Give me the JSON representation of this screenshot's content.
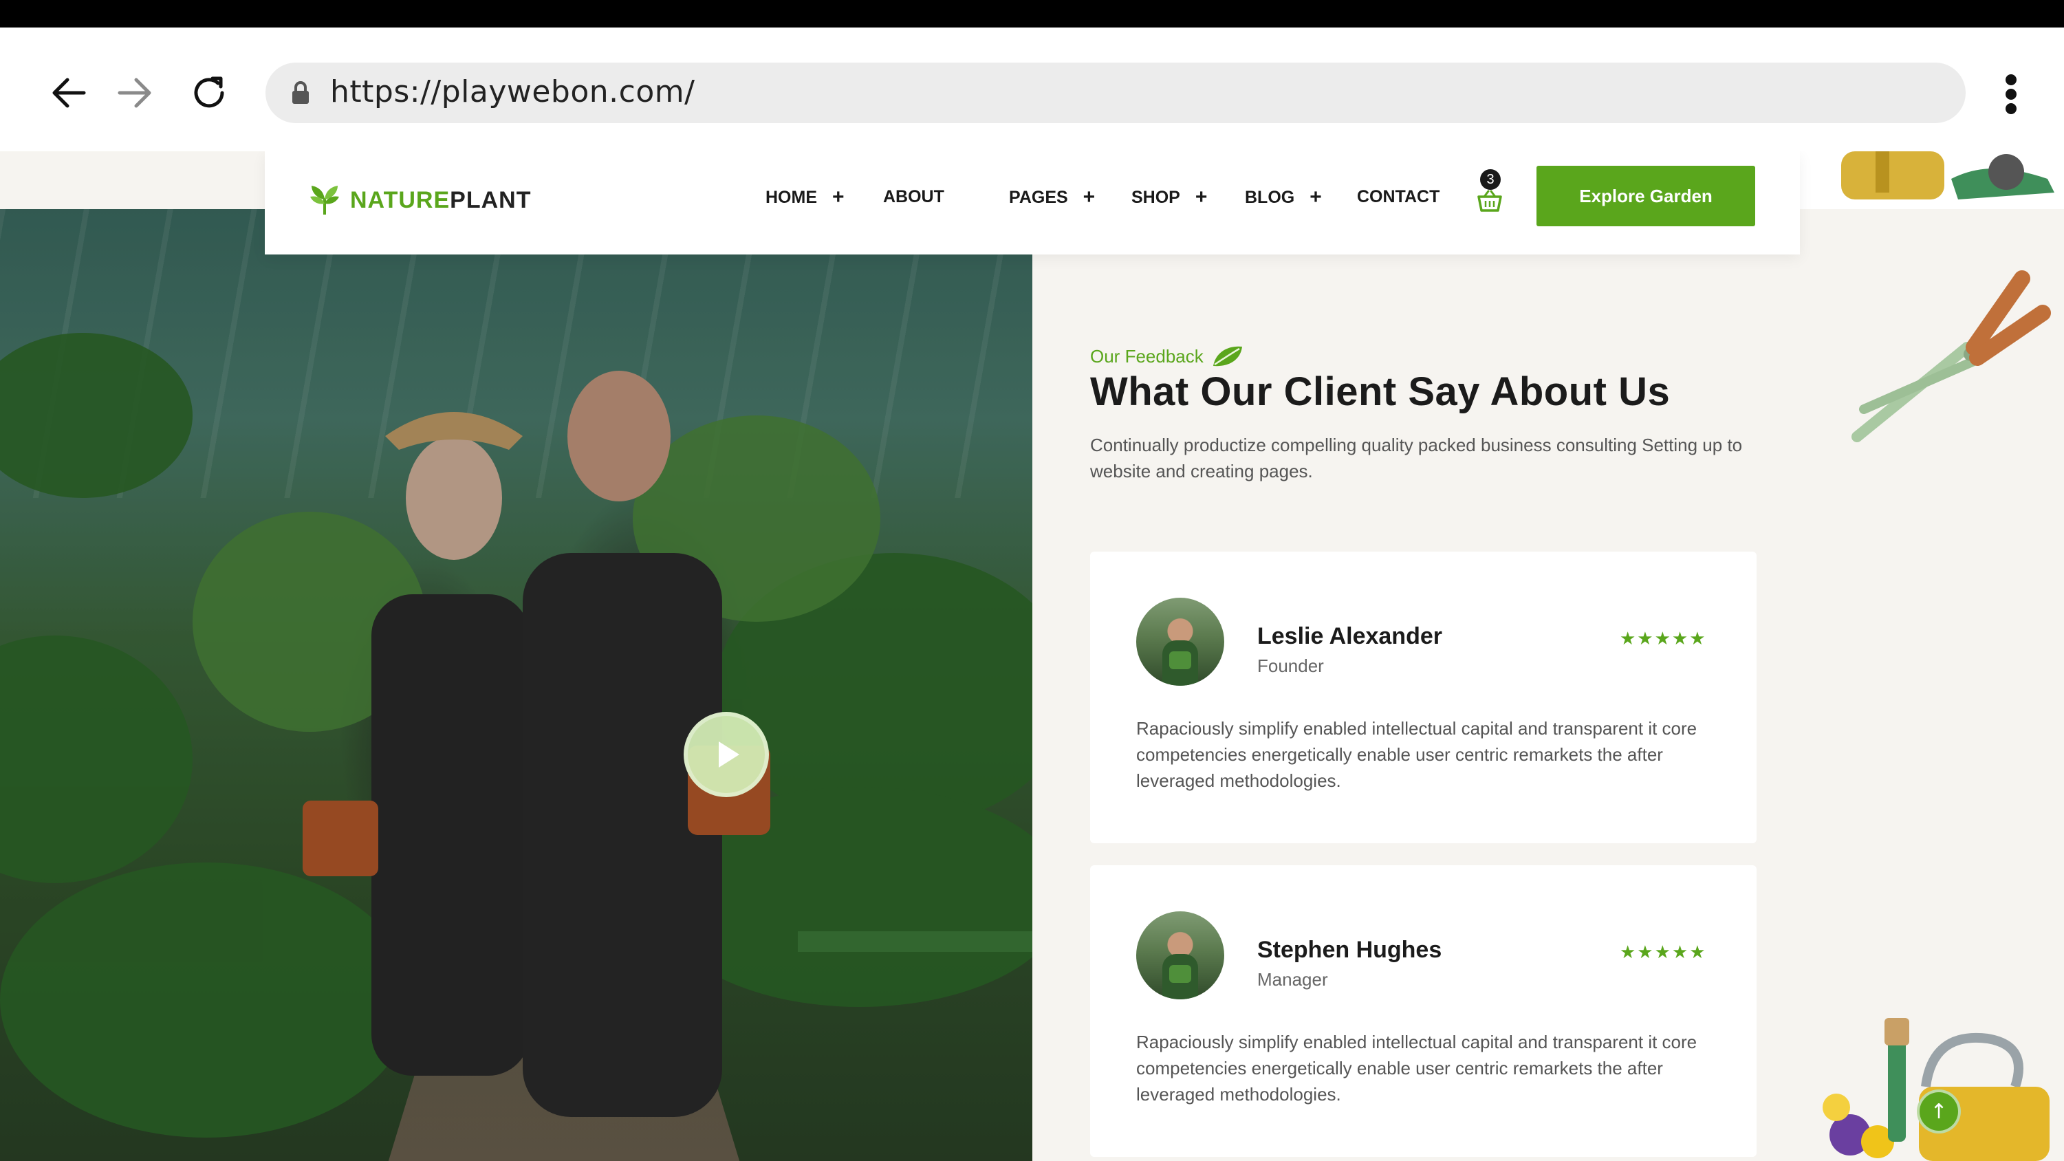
{
  "browser": {
    "url": "https://playwebon.com/",
    "back_icon": "back-arrow-icon",
    "forward_icon": "forward-arrow-icon",
    "reload_icon": "reload-icon",
    "menu_icon": "kebab-menu-icon"
  },
  "header": {
    "logo_part1": "NATURE",
    "logo_part2": "PLANT",
    "nav": [
      {
        "label": "HOME",
        "has_plus": true
      },
      {
        "label": "ABOUT",
        "has_plus": false
      },
      {
        "label": "PAGES",
        "has_plus": true
      },
      {
        "label": "SHOP",
        "has_plus": true
      },
      {
        "label": "BLOG",
        "has_plus": true
      },
      {
        "label": "CONTACT",
        "has_plus": false
      }
    ],
    "plus_symbol": "+",
    "cart_count": "3",
    "cta_label": "Explore Garden"
  },
  "section": {
    "eyebrow": "Our Feedback",
    "title": "What Our Client Say About Us",
    "intro": "Continually productize compelling quality packed business consulting Setting up to website and creating pages."
  },
  "testimonials": [
    {
      "name": "Leslie Alexander",
      "role": "Founder",
      "stars": "★★★★★",
      "rating": 5,
      "quote": "Rapaciously simplify enabled intellectual capital and transparent it core competencies energetically enable user centric remarkets the after leveraged methodologies."
    },
    {
      "name": "Stephen Hughes",
      "role": "Manager",
      "stars": "★★★★★",
      "rating": 5,
      "quote": "Rapaciously simplify enabled intellectual capital and transparent it core competencies energetically enable user centric remarkets the after leveraged methodologies."
    }
  ],
  "scroll_top_symbol": "↑",
  "colors": {
    "accent": "#5aa61c",
    "text_dark": "#1b1b1b",
    "section_bg": "#f6f4f0"
  }
}
